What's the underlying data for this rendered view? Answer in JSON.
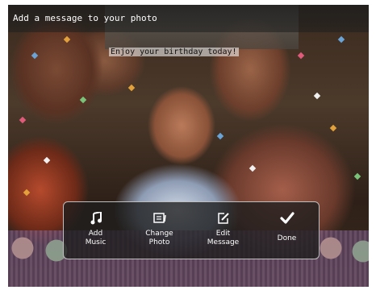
{
  "header": {
    "title": "Add a message to your photo"
  },
  "photo": {
    "message_text": "Enjoy your birthday today!"
  },
  "menu": {
    "items": [
      {
        "label_line1": "Add",
        "label_line2": "Music",
        "icon": "music-note-icon"
      },
      {
        "label_line1": "Change",
        "label_line2": "Photo",
        "icon": "photo-frame-icon"
      },
      {
        "label_line1": "Edit",
        "label_line2": "Message",
        "icon": "edit-icon"
      },
      {
        "label_line1": "Done",
        "label_line2": "",
        "icon": "checkmark-icon"
      }
    ]
  },
  "colors": {
    "menu_bg": "#1e1e1e",
    "menu_border": "#bfbfbf",
    "text": "#ffffff"
  }
}
